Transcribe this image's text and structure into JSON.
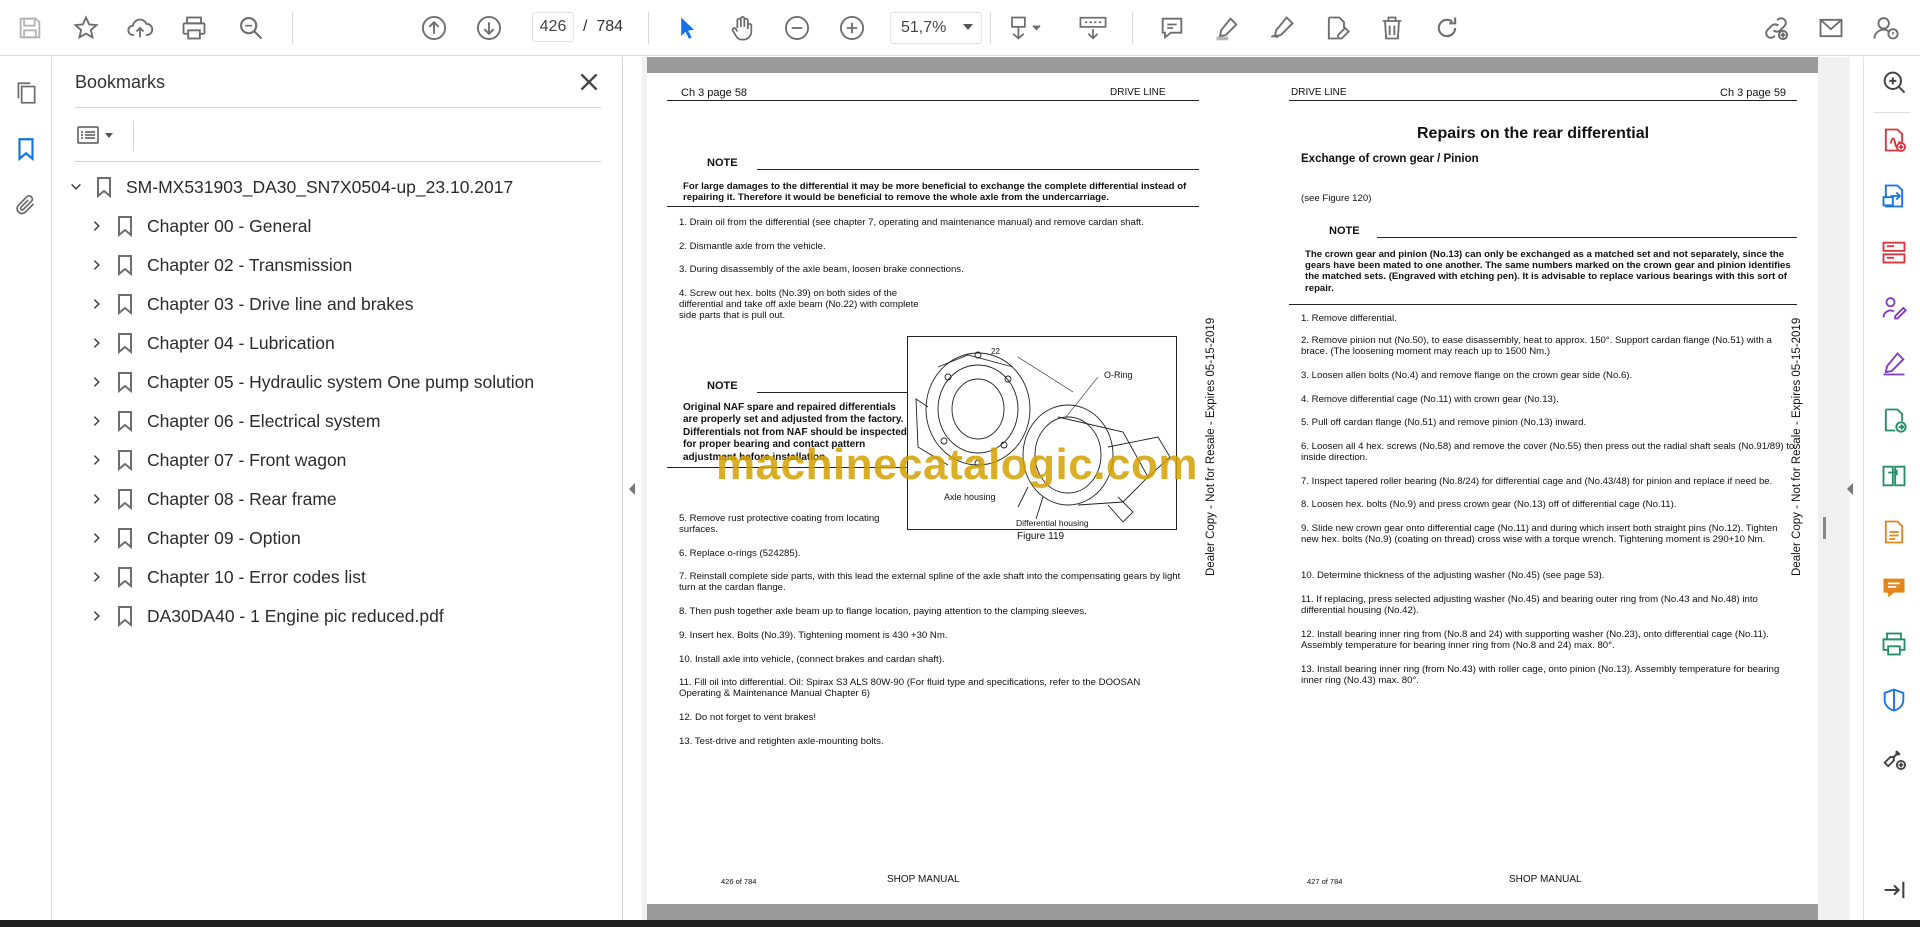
{
  "toolbar": {
    "current_page": "426",
    "page_separator": "/",
    "total_pages": "784",
    "zoom": "51,7%"
  },
  "bookmarks_panel": {
    "title": "Bookmarks",
    "root": "SM-MX531903_DA30_SN7X0504-up_23.10.2017",
    "items": [
      {
        "label": "Chapter 00 - General"
      },
      {
        "label": "Chapter 02 - Transmission"
      },
      {
        "label": "Chapter 03 - Drive line and brakes"
      },
      {
        "label": "Chapter 04 - Lubrication"
      },
      {
        "label": "Chapter 05 - Hydraulic system One pump solution"
      },
      {
        "label": "Chapter 06 - Electrical system"
      },
      {
        "label": "Chapter 07 - Front wagon"
      },
      {
        "label": "Chapter 08 - Rear frame"
      },
      {
        "label": "Chapter 09 - Option"
      },
      {
        "label": "Chapter 10 - Error codes list"
      },
      {
        "label": "DA30DA40 - 1 Engine pic reduced.pdf"
      }
    ]
  },
  "left_page": {
    "header_left": "Ch 3 page 58",
    "header_right": "DRIVE LINE",
    "note1_label": "NOTE",
    "note1_text": "For large damages to the differential it may be more beneficial to exchange the complete differential instead of repairing it. Therefore it would be beneficial to remove the whole axle from the undercarriage.",
    "steps_a": [
      "1. Drain oil from the differential (see chapter 7, operating and maintenance manual) and remove cardan shaft.",
      "2. Dismantle axle from the vehicle.",
      "3. During disassembly of the axle beam, loosen brake connections.",
      "4. Screw out hex. bolts (No.39) on both sides of the differential and take off axle beam (No.22) with complete side parts that is pull out."
    ],
    "note2_label": "NOTE",
    "note2_text": "Original NAF spare and repaired differentials are properly set and adjusted from the factory. Differentials not from NAF should be inspected for proper bearing and contact pattern adjustment before installation.",
    "figure_labels": {
      "num": "22",
      "oring": "O-Ring",
      "axle": "Axle housing",
      "diff": "Differential housing",
      "caption": "Figure 119"
    },
    "steps_b": [
      "5. Remove rust protective coating from locating surfaces.",
      "6. Replace o-rings (524285).",
      "7. Reinstall complete side parts, with this lead the external spline of the axle shaft into the compensating gears by light turn at the cardan flange.",
      "8. Then push together axle beam up to flange location, paying attention to the clamping sleeves.",
      "9. Insert hex. Bolts (No.39). Tightening moment is 430 +30 Nm.",
      "10. Install axle into vehicle, (connect brakes and cardan shaft).",
      "11. Fill oil into differential. Oil: Spirax S3 ALS 80W-90 (For fluid type and specifications, refer to the DOOSAN Operating & Maintenance Manual Chapter 6)",
      "12. Do not forget to vent brakes!",
      "13. Test-drive and retighten axle-mounting bolts."
    ],
    "footer_num": "426 of 784",
    "footer_title": "SHOP MANUAL",
    "side_stamp": "Dealer Copy - Not for Resale - Expires 05-15-2019"
  },
  "right_page": {
    "header_left": "DRIVE LINE",
    "header_right": "Ch 3 page 59",
    "title": "Repairs on the rear differential",
    "subtitle": "Exchange of crown gear / Pinion",
    "see_fig": "(see Figure 120)",
    "note_label": "NOTE",
    "note_text": "The crown gear and pinion (No.13) can only be exchanged as a matched set and not separately, since the gears have been mated to one another. The same numbers marked on the crown gear and pinion identifies the matched sets. (Engraved with etching pen). It is advisable to replace various bearings with this sort of repair.",
    "steps": [
      "1. Remove differential.",
      "2. Remove pinion nut (No.50), to ease disassembly, heat to approx. 150°. Support cardan flange (No.51) with a brace. (The loosening moment may reach up to 1500 Nm.)",
      "3. Loosen allen bolts (No.4) and remove flange on the crown gear side (No.6).",
      "4. Remove differential cage (No.11) with crown gear (No.13).",
      "5. Pull off cardan flange (No.51) and remove pinion (No.13) inward.",
      "6. Loosen all 4 hex. screws (No.58) and remove the cover (No.55) then press out the radial shaft seals (No.91/89) to inside direction.",
      "7. Inspect tapered roller bearing (No.8/24) for differential cage and (No.43/48) for pinion and replace if need be.",
      "8. Loosen hex. bolts (No.9) and press crown gear (No.13) off of differential cage (No.11).",
      "9. Slide new crown gear onto differential cage (No.11) and during which insert both straight pins (No.12). Tighten new hex. bolts (No.9) (coating on thread) cross wise with a torque wrench. Tightening moment is 290+10 Nm.",
      "10. Determine thickness of the adjusting washer (No.45) (see page 53).",
      "11. If replacing, press selected adjusting washer (No.45) and bearing outer ring from (No.43 and No.48) into differential housing (No.42).",
      "12. Install bearing inner ring from (No.8 and 24) with supporting washer (No.23), onto differential cage (No.11). Assembly temperature for bearing inner ring from (No.8 and 24) max. 80°.",
      "13. Install bearing inner ring (from No.43) with roller cage, onto pinion (No.13). Assembly temperature for bearing inner ring (No.43) max. 80°."
    ],
    "footer_num": "427 of 784",
    "footer_title": "SHOP MANUAL",
    "side_stamp": "Dealer Copy - Not for Resale - Expires 05-15-2019"
  },
  "watermark": "machinecatalogic.com",
  "colors": {
    "accent_blue": "#1473e6",
    "icon_gray": "#6e6e6e",
    "red": "#d7373f",
    "purple": "#7e3cc8",
    "green": "#268e6c",
    "gold": "#e68619"
  }
}
